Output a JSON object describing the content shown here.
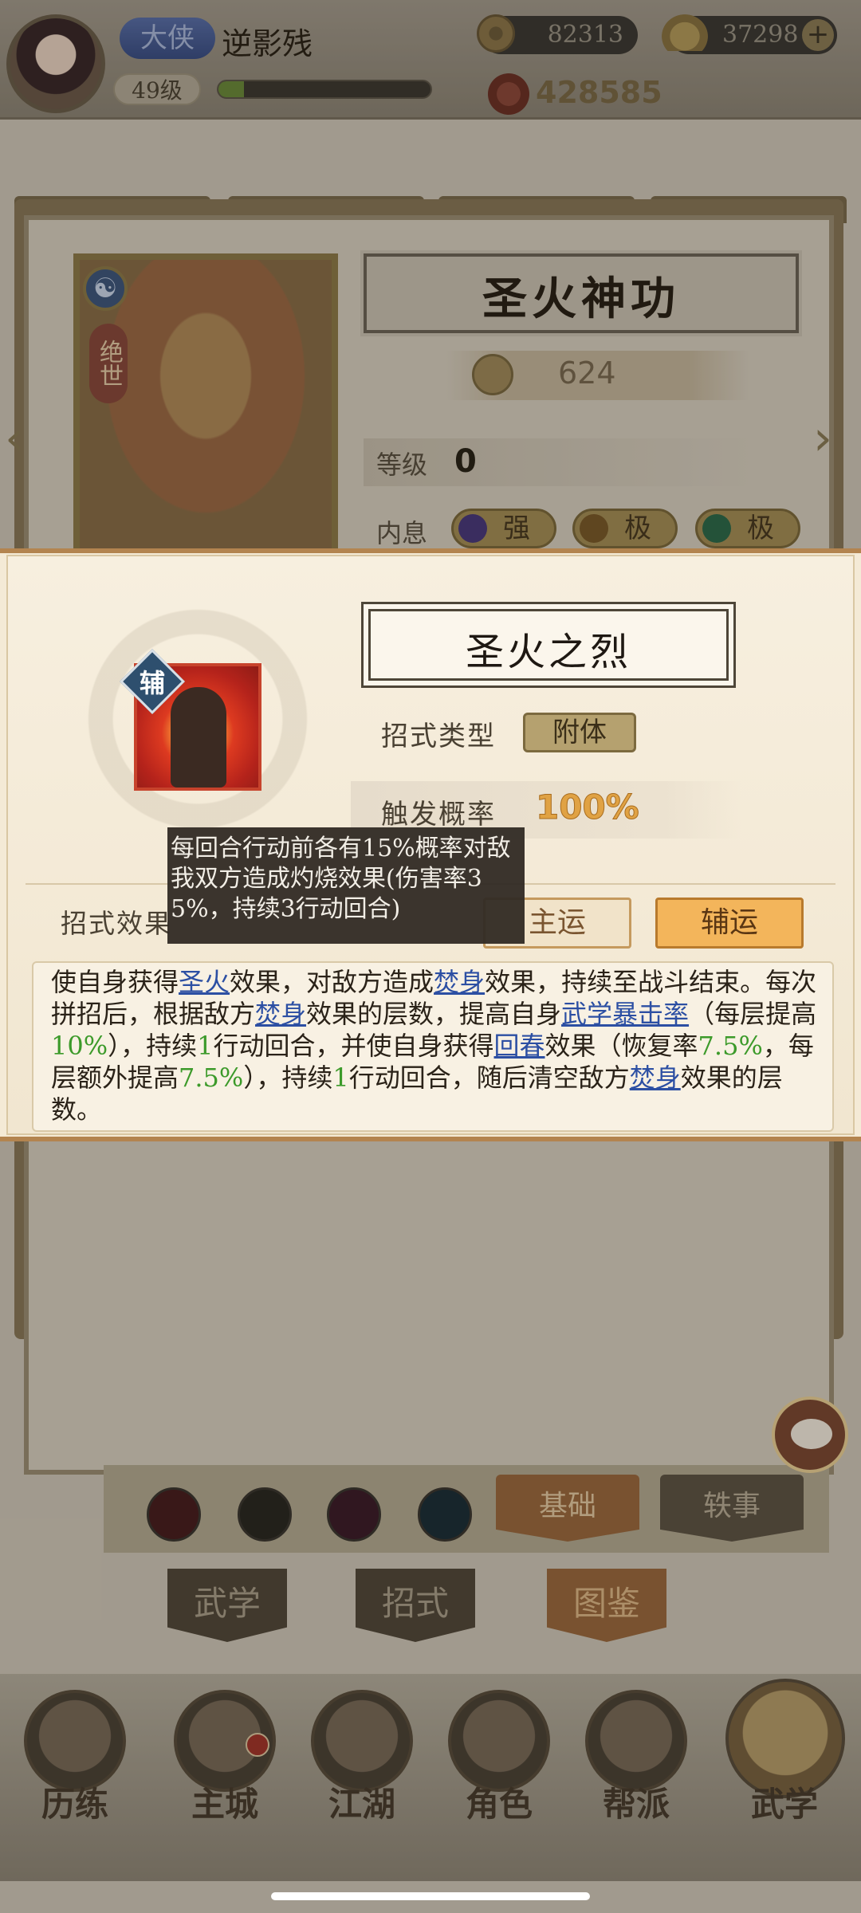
{
  "player": {
    "title": "大侠",
    "name": "逆影残",
    "level": "49级",
    "exp_fraction": 0.12,
    "coins": "82313",
    "ingots": "37298",
    "power": "428585"
  },
  "skill": {
    "name": "圣火神功",
    "rarity": "绝世",
    "score": "624",
    "level_label": "等级",
    "level_value": "0",
    "inner_label": "内息",
    "inner_traits": [
      "强",
      "极",
      "极"
    ]
  },
  "bottom": {
    "subtabs": [
      "基础",
      "轶事"
    ],
    "main_tabs": [
      "武学",
      "招式",
      "图鉴"
    ],
    "nav": [
      "历练",
      "主城",
      "江湖",
      "角色",
      "帮派",
      "武学"
    ]
  },
  "popup": {
    "tag": "辅",
    "move_name": "圣火之烈",
    "type_label": "招式类型",
    "type_value": "附体",
    "trigger_label": "触发概率",
    "trigger_value": "100%",
    "effect_label": "招式效果",
    "main_btn": "主运",
    "aux_btn": "辅运",
    "description": [
      {
        "t": "使自身获得"
      },
      {
        "t": "圣火",
        "k": "kw"
      },
      {
        "t": "效果，对敌方造成"
      },
      {
        "t": "焚身",
        "k": "kw"
      },
      {
        "t": "效果，持续至战斗结束。每次拼招后，根据敌方"
      },
      {
        "t": "焚身",
        "k": "kw"
      },
      {
        "t": "效果的层数，提高自身"
      },
      {
        "t": "武学暴击率",
        "k": "kw"
      },
      {
        "t": "（每层提高"
      },
      {
        "t": "10%",
        "k": "num"
      },
      {
        "t": "），持续"
      },
      {
        "t": "1",
        "k": "num"
      },
      {
        "t": "行动回合，并使自身获得"
      },
      {
        "t": "回春",
        "k": "kw"
      },
      {
        "t": "效果（恢复率"
      },
      {
        "t": "7.5%",
        "k": "num"
      },
      {
        "t": "，每层额外提高"
      },
      {
        "t": "7.5%",
        "k": "num"
      },
      {
        "t": "），持续"
      },
      {
        "t": "1",
        "k": "num"
      },
      {
        "t": "行动回合，随后清空敌方"
      },
      {
        "t": "焚身",
        "k": "kw"
      },
      {
        "t": "效果的层数。"
      }
    ],
    "tooltip": "每回合行动前各有15%概率对敌我双方造成灼烧效果(伤害率35%，持续3行动回合)"
  }
}
